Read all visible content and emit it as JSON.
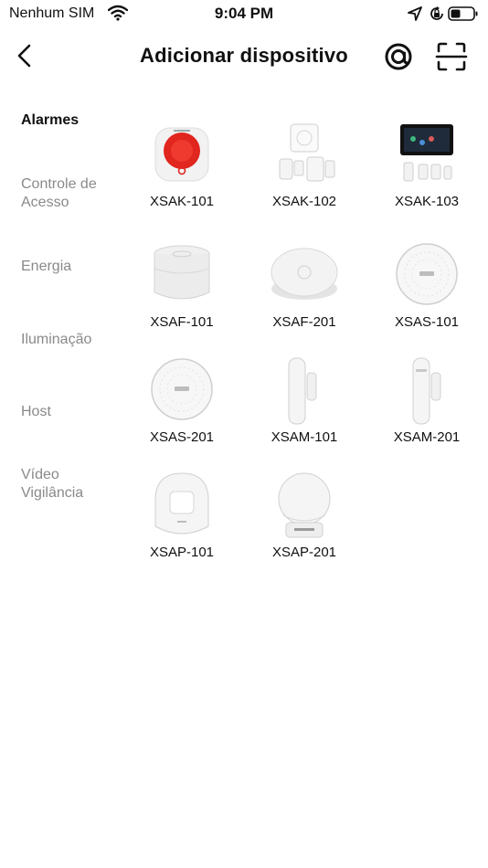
{
  "status_bar": {
    "carrier": "Nenhum SIM",
    "time": "9:04 PM"
  },
  "header": {
    "title": "Adicionar dispositivo"
  },
  "sidebar": {
    "items": [
      {
        "label": "Alarmes",
        "active": true
      },
      {
        "label": "Controle de Acesso",
        "active": false
      },
      {
        "label": "Energia",
        "active": false
      },
      {
        "label": "Iluminação",
        "active": false
      },
      {
        "label": "Host",
        "active": false
      },
      {
        "label": "Vídeo Vigilância",
        "active": false
      }
    ]
  },
  "devices": [
    {
      "label": "XSAK-101",
      "icon": "siren-device-icon"
    },
    {
      "label": "XSAK-102",
      "icon": "alarm-kit-icon"
    },
    {
      "label": "XSAK-103",
      "icon": "touchscreen-alarm-kit-icon"
    },
    {
      "label": "XSAF-101",
      "icon": "smoke-detector-icon"
    },
    {
      "label": "XSAF-201",
      "icon": "smoke-detector-flat-icon"
    },
    {
      "label": "XSAS-101",
      "icon": "round-hub-icon"
    },
    {
      "label": "XSAS-201",
      "icon": "round-hub-icon"
    },
    {
      "label": "XSAM-101",
      "icon": "door-sensor-icon"
    },
    {
      "label": "XSAM-201",
      "icon": "door-sensor-icon"
    },
    {
      "label": "XSAP-101",
      "icon": "motion-sensor-icon"
    },
    {
      "label": "XSAP-201",
      "icon": "motion-sensor-dome-icon"
    }
  ]
}
